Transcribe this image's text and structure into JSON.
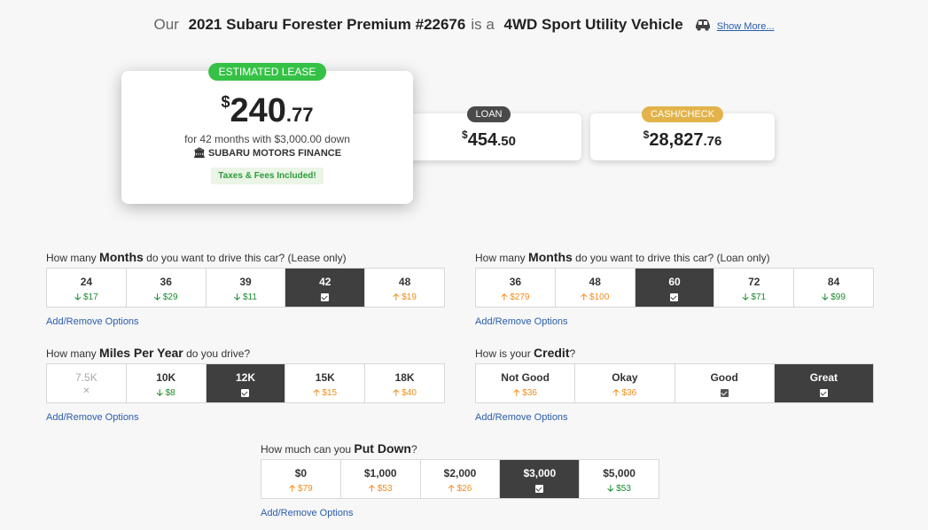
{
  "header": {
    "prefix": "Our",
    "vehicle": "2021 Subaru Forester Premium #22676",
    "middle": "is a",
    "body_type": "4WD Sport Utility Vehicle",
    "show_more": "Show More..."
  },
  "lease": {
    "badge": "ESTIMATED LEASE",
    "currency": "$",
    "dollars": "240",
    "cents": ".77",
    "terms": "for 42 months with $3,000.00 down",
    "lender": "SUBARU MOTORS FINANCE",
    "taxes": "Taxes & Fees Included!"
  },
  "loan": {
    "badge": "LOAN",
    "currency": "$",
    "dollars": "454",
    "cents": ".50"
  },
  "cash": {
    "badge": "CASH/CHECK",
    "currency": "$",
    "dollars": "28,827",
    "cents": ".76"
  },
  "lease_months": {
    "q_pre": "How many",
    "q_bold": "Months",
    "q_post": "do you want to drive this car? (Lease only)",
    "options": [
      {
        "label": "24",
        "delta": "$17",
        "dir": "down"
      },
      {
        "label": "36",
        "delta": "$29",
        "dir": "down"
      },
      {
        "label": "39",
        "delta": "$11",
        "dir": "down"
      },
      {
        "label": "42",
        "selected": true
      },
      {
        "label": "48",
        "delta": "$19",
        "dir": "up"
      }
    ],
    "link": "Add/Remove Options"
  },
  "loan_months": {
    "q_pre": "How many",
    "q_bold": "Months",
    "q_post": "do you want to drive this car? (Loan only)",
    "options": [
      {
        "label": "36",
        "delta": "$279",
        "dir": "up"
      },
      {
        "label": "48",
        "delta": "$100",
        "dir": "up"
      },
      {
        "label": "60",
        "selected": true
      },
      {
        "label": "72",
        "delta": "$71",
        "dir": "down"
      },
      {
        "label": "84",
        "delta": "$99",
        "dir": "down"
      }
    ],
    "link": "Add/Remove Options"
  },
  "miles": {
    "q_pre": "How many",
    "q_bold": "Miles Per Year",
    "q_post": "do you drive?",
    "options": [
      {
        "label": "7.5K",
        "disabled": true
      },
      {
        "label": "10K",
        "delta": "$8",
        "dir": "down"
      },
      {
        "label": "12K",
        "selected": true
      },
      {
        "label": "15K",
        "delta": "$15",
        "dir": "up"
      },
      {
        "label": "18K",
        "delta": "$40",
        "dir": "up"
      }
    ],
    "link": "Add/Remove Options"
  },
  "credit": {
    "q_pre": "How is your",
    "q_bold": "Credit",
    "q_post": "?",
    "options": [
      {
        "label": "Not Good",
        "delta": "$36",
        "dir": "up"
      },
      {
        "label": "Okay",
        "delta": "$36",
        "dir": "up"
      },
      {
        "label": "Good",
        "checked": true
      },
      {
        "label": "Great",
        "selected": true
      }
    ],
    "link": "Add/Remove Options"
  },
  "down": {
    "q_pre": "How much can you",
    "q_bold": "Put Down",
    "q_post": "?",
    "options": [
      {
        "label": "$0",
        "delta": "$79",
        "dir": "up"
      },
      {
        "label": "$1,000",
        "delta": "$53",
        "dir": "up"
      },
      {
        "label": "$2,000",
        "delta": "$26",
        "dir": "up"
      },
      {
        "label": "$3,000",
        "selected": true
      },
      {
        "label": "$5,000",
        "delta": "$53",
        "dir": "down"
      }
    ],
    "link": "Add/Remove Options"
  },
  "colors": {
    "selected_bg": "#3f3f3f",
    "up": "#f08c1b",
    "down": "#1a8a2e",
    "link": "#2a5cab",
    "lease_badge": "#35c145",
    "cash_badge": "#e2b34a"
  }
}
